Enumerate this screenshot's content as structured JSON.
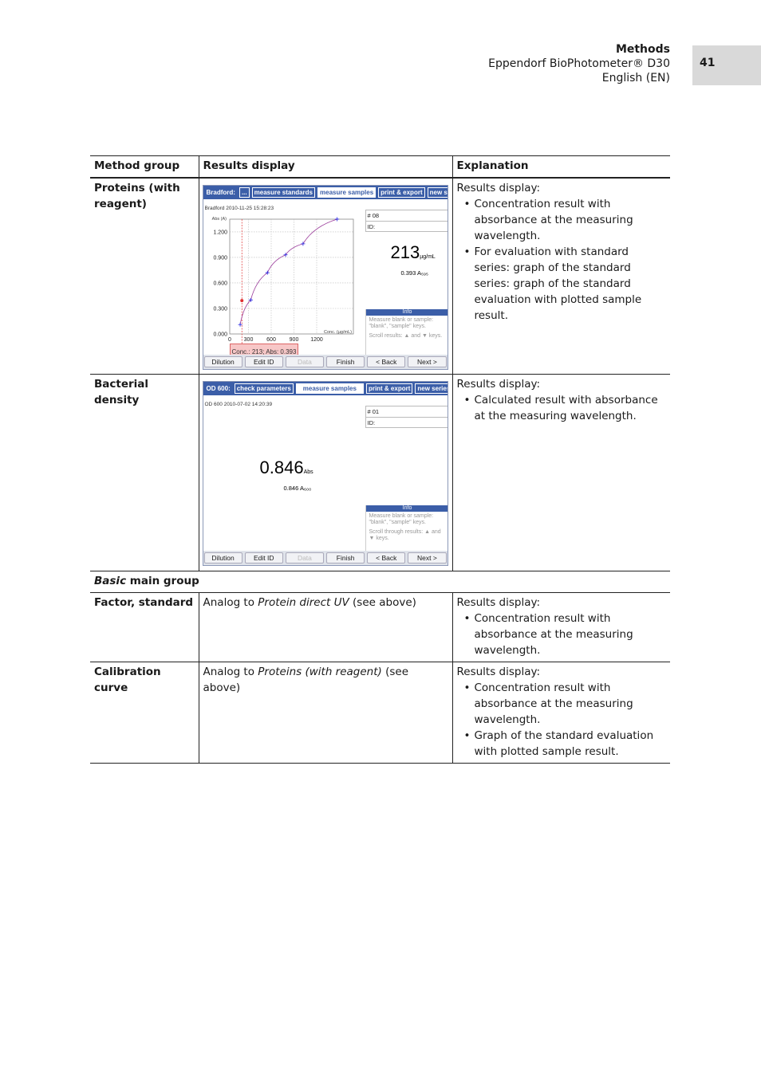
{
  "header": {
    "section": "Methods",
    "product": "Eppendorf BioPhotometer® D30",
    "language": "English (EN)",
    "page": "41"
  },
  "table": {
    "headers": [
      "Method group",
      "Results display",
      "Explanation"
    ],
    "rows": [
      {
        "group": "Proteins (with reagent)",
        "explanation_intro": "Results display:",
        "bullets": [
          "Concentration result with absorbance at the measuring wavelength.",
          "For evaluation with standard series: graph of the standard series: graph of the standard evaluation with plotted sample result."
        ]
      },
      {
        "group": "Bacterial density",
        "explanation_intro": "Results display:",
        "bullets": [
          "Calculated result with absorbance at the measuring wavelength."
        ]
      },
      {
        "main_group_italic": "Basic",
        "main_group_rest": " main group"
      },
      {
        "group": "Factor, standard",
        "display_pre": "Analog to ",
        "display_italic": "Protein direct UV",
        "display_post": " (see above)",
        "explanation_intro": "Results display:",
        "bullets": [
          "Concentration result with absorbance at the measuring wavelength."
        ]
      },
      {
        "group": "Calibration curve",
        "display_pre": "Analog to ",
        "display_italic": "Proteins (with reagent)",
        "display_post": " (see above)",
        "explanation_intro": "Results display:",
        "bullets": [
          "Concentration result with absorbance at the measuring wavelength.",
          "Graph of the standard evaluation with plotted sample result."
        ]
      }
    ]
  },
  "screen1": {
    "tabs": [
      "Bradford:",
      "...",
      "measure standards",
      "measure samples",
      "print & export",
      "new series"
    ],
    "timestamp": "Bradford 2010-11-25 15:28:23",
    "sample_no": "# 08",
    "id_label": "ID:",
    "result": "213",
    "unit": "µg/mL",
    "abs": "0.393 A₅₉₅",
    "info_title": "Info",
    "info_1": "Measure blank or sample: \"blank\", \"sample\" keys.",
    "info_2": "Scroll results: ▲ and ▼ keys.",
    "conc_label": "Conc.: 213; Abs: 0.393",
    "buttons": [
      "Dilution",
      "Edit ID",
      "Data",
      "Finish",
      "< Back",
      "Next >"
    ],
    "chart_data": {
      "type": "scatter",
      "ylabel": "Abs (A)",
      "xlabel": "Conc. (µg/mL)",
      "xticks": [
        "0",
        "300",
        "600",
        "900",
        "1200"
      ],
      "yticks": [
        "0.000",
        "0.300",
        "0.600",
        "0.900",
        "1.200"
      ],
      "ylim": [
        0,
        1.3
      ],
      "grid": true,
      "standards": [
        {
          "x": 190,
          "y": 0.11
        },
        {
          "x": 330,
          "y": 0.4
        },
        {
          "x": 550,
          "y": 0.72
        },
        {
          "x": 790,
          "y": 0.93
        },
        {
          "x": 1020,
          "y": 1.06
        },
        {
          "x": 1470,
          "y": 1.35
        }
      ],
      "sample": {
        "x": 213,
        "y": 0.393
      },
      "sample_color": "#e03030",
      "standard_color": "#2020e0",
      "curve_color": "#9a3a9a"
    }
  },
  "screen2": {
    "tabs": [
      "OD 600:",
      "check parameters",
      "measure samples",
      "print & export",
      "new series"
    ],
    "timestamp": "OD 600 2010-07-02 14:20:39",
    "sample_no": "# 01",
    "id_label": "ID:",
    "result": "0.846",
    "unit": "Abs",
    "abs": "0.846 A₆₀₀",
    "info_title": "Info",
    "info_1": "Measure blank or sample: \"blank\", \"sample\" keys.",
    "info_2": "Scroll through results: ▲ and ▼ keys.",
    "buttons": [
      "Dilution",
      "Edit ID",
      "Data",
      "Finish",
      "< Back",
      "Next >"
    ]
  }
}
